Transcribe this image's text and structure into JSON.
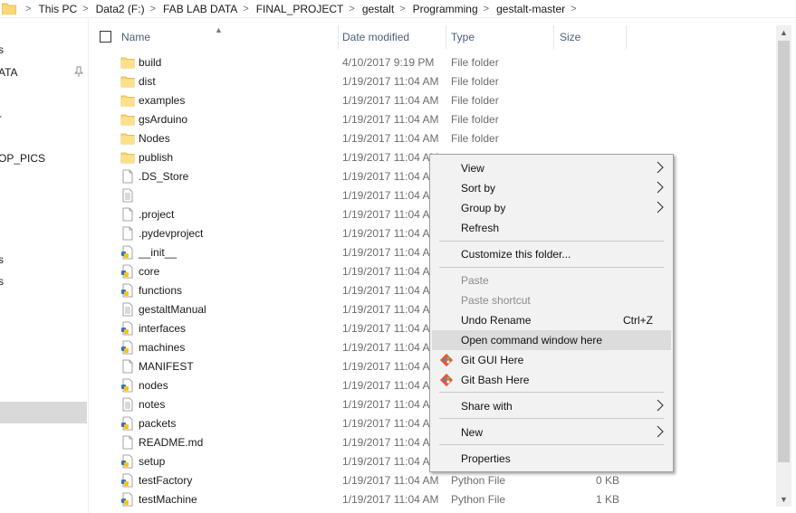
{
  "breadcrumb": [
    "This PC",
    "Data2 (F:)",
    "FAB LAB DATA",
    "FINAL_PROJECT",
    "gestalt",
    "Programming",
    "gestalt-master"
  ],
  "nav": {
    "items": [
      "s",
      "ATA",
      "-",
      "OP_PICS",
      "s",
      "s"
    ]
  },
  "columns": {
    "name": "Name",
    "date": "Date modified",
    "type": "Type",
    "size": "Size"
  },
  "files": [
    {
      "name": "build",
      "date": "4/10/2017 9:19 PM",
      "type": "File folder",
      "size": "",
      "icon": "folder-icon"
    },
    {
      "name": "dist",
      "date": "1/19/2017 11:04 AM",
      "type": "File folder",
      "size": "",
      "icon": "folder-icon"
    },
    {
      "name": "examples",
      "date": "1/19/2017 11:04 AM",
      "type": "File folder",
      "size": "",
      "icon": "folder-icon"
    },
    {
      "name": "gsArduino",
      "date": "1/19/2017 11:04 AM",
      "type": "File folder",
      "size": "",
      "icon": "folder-icon"
    },
    {
      "name": "Nodes",
      "date": "1/19/2017 11:04 AM",
      "type": "File folder",
      "size": "",
      "icon": "folder-icon"
    },
    {
      "name": "publish",
      "date": "1/19/2017 11:04 AM",
      "type": "",
      "size": "",
      "icon": "folder-icon"
    },
    {
      "name": ".DS_Store",
      "date": "1/19/2017 11:04 AM",
      "type": "",
      "size": "",
      "icon": "file-icon"
    },
    {
      "name": "",
      "date": "1/19/2017 11:04 AM",
      "type": "",
      "size": "",
      "icon": "text-file-icon"
    },
    {
      "name": ".project",
      "date": "1/19/2017 11:04 AM",
      "type": "",
      "size": "",
      "icon": "file-icon"
    },
    {
      "name": ".pydevproject",
      "date": "1/19/2017 11:04 AM",
      "type": "",
      "size": "",
      "icon": "file-icon"
    },
    {
      "name": "__init__",
      "date": "1/19/2017 11:04 AM",
      "type": "",
      "size": "",
      "icon": "python-file-icon"
    },
    {
      "name": "core",
      "date": "1/19/2017 11:04 AM",
      "type": "",
      "size": "",
      "icon": "python-file-icon"
    },
    {
      "name": "functions",
      "date": "1/19/2017 11:04 AM",
      "type": "",
      "size": "",
      "icon": "python-file-icon"
    },
    {
      "name": "gestaltManual",
      "date": "1/19/2017 11:04 AM",
      "type": "",
      "size": "",
      "icon": "text-file-icon"
    },
    {
      "name": "interfaces",
      "date": "1/19/2017 11:04 AM",
      "type": "",
      "size": "",
      "icon": "python-file-icon"
    },
    {
      "name": "machines",
      "date": "1/19/2017 11:04 AM",
      "type": "",
      "size": "",
      "icon": "python-file-icon"
    },
    {
      "name": "MANIFEST",
      "date": "1/19/2017 11:04 AM",
      "type": "",
      "size": "",
      "icon": "file-icon"
    },
    {
      "name": "nodes",
      "date": "1/19/2017 11:04 AM",
      "type": "",
      "size": "",
      "icon": "python-file-icon"
    },
    {
      "name": "notes",
      "date": "1/19/2017 11:04 AM",
      "type": "",
      "size": "",
      "icon": "text-file-icon"
    },
    {
      "name": "packets",
      "date": "1/19/2017 11:04 AM",
      "type": "",
      "size": "",
      "icon": "python-file-icon"
    },
    {
      "name": "README.md",
      "date": "1/19/2017 11:04 AM",
      "type": "",
      "size": "",
      "icon": "file-icon"
    },
    {
      "name": "setup",
      "date": "1/19/2017 11:04 AM",
      "type": "",
      "size": "",
      "icon": "python-file-icon"
    },
    {
      "name": "testFactory",
      "date": "1/19/2017 11:04 AM",
      "type": "Python File",
      "size": "0 KB",
      "icon": "python-file-icon"
    },
    {
      "name": "testMachine",
      "date": "1/19/2017 11:04 AM",
      "type": "Python File",
      "size": "1 KB",
      "icon": "python-file-icon"
    }
  ],
  "context_menu": {
    "items": [
      {
        "label": "View",
        "submenu": true
      },
      {
        "label": "Sort by",
        "submenu": true
      },
      {
        "label": "Group by",
        "submenu": true
      },
      {
        "label": "Refresh"
      },
      {
        "label": "Customize this folder..."
      },
      {
        "label": "Paste",
        "disabled": true
      },
      {
        "label": "Paste shortcut",
        "disabled": true
      },
      {
        "label": "Undo Rename",
        "shortcut": "Ctrl+Z"
      },
      {
        "label": "Open command window here",
        "highlighted": true
      },
      {
        "label": "Git GUI Here",
        "icon": "git-icon"
      },
      {
        "label": "Git Bash Here",
        "icon": "git-icon"
      },
      {
        "label": "Share with",
        "submenu": true
      },
      {
        "label": "New",
        "submenu": true
      },
      {
        "label": "Properties"
      }
    ]
  },
  "colors": {
    "header_text": "#4c607a",
    "folder_yellow": "#f8d775",
    "menu_bg": "#f2f2f2",
    "menu_highlight": "#dcdcdc",
    "selection_gray": "#d9d9d9"
  }
}
